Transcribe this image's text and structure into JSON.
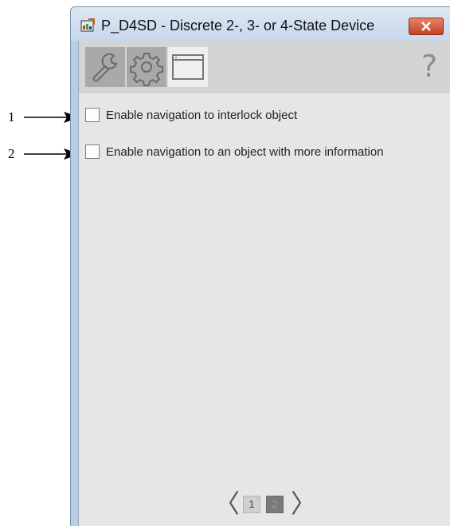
{
  "callouts": [
    {
      "number": "1"
    },
    {
      "number": "2"
    }
  ],
  "window": {
    "title": "P_D4SD - Discrete 2-, 3- or 4-State Device",
    "close_icon": "close-icon",
    "app_icon": "device-faceplate-icon"
  },
  "toolbar": {
    "tabs": [
      {
        "icon": "wrench-icon",
        "state": "inactive"
      },
      {
        "icon": "gear-icon",
        "state": "inactive"
      },
      {
        "icon": "window-icon",
        "state": "active"
      }
    ],
    "help_label": "?"
  },
  "options": [
    {
      "label": "Enable navigation to interlock object",
      "checked": false
    },
    {
      "label": "Enable navigation to an object with more information",
      "checked": false
    }
  ],
  "pagination": {
    "prev_label": "〈",
    "next_label": "〉",
    "pages": [
      "1",
      "2"
    ],
    "current_page": "2"
  },
  "colors": {
    "close_button": "#c9472a",
    "active_tab": "#efefef",
    "inactive_tab": "#a9a9a9",
    "window_frame": "#b9cde3"
  }
}
